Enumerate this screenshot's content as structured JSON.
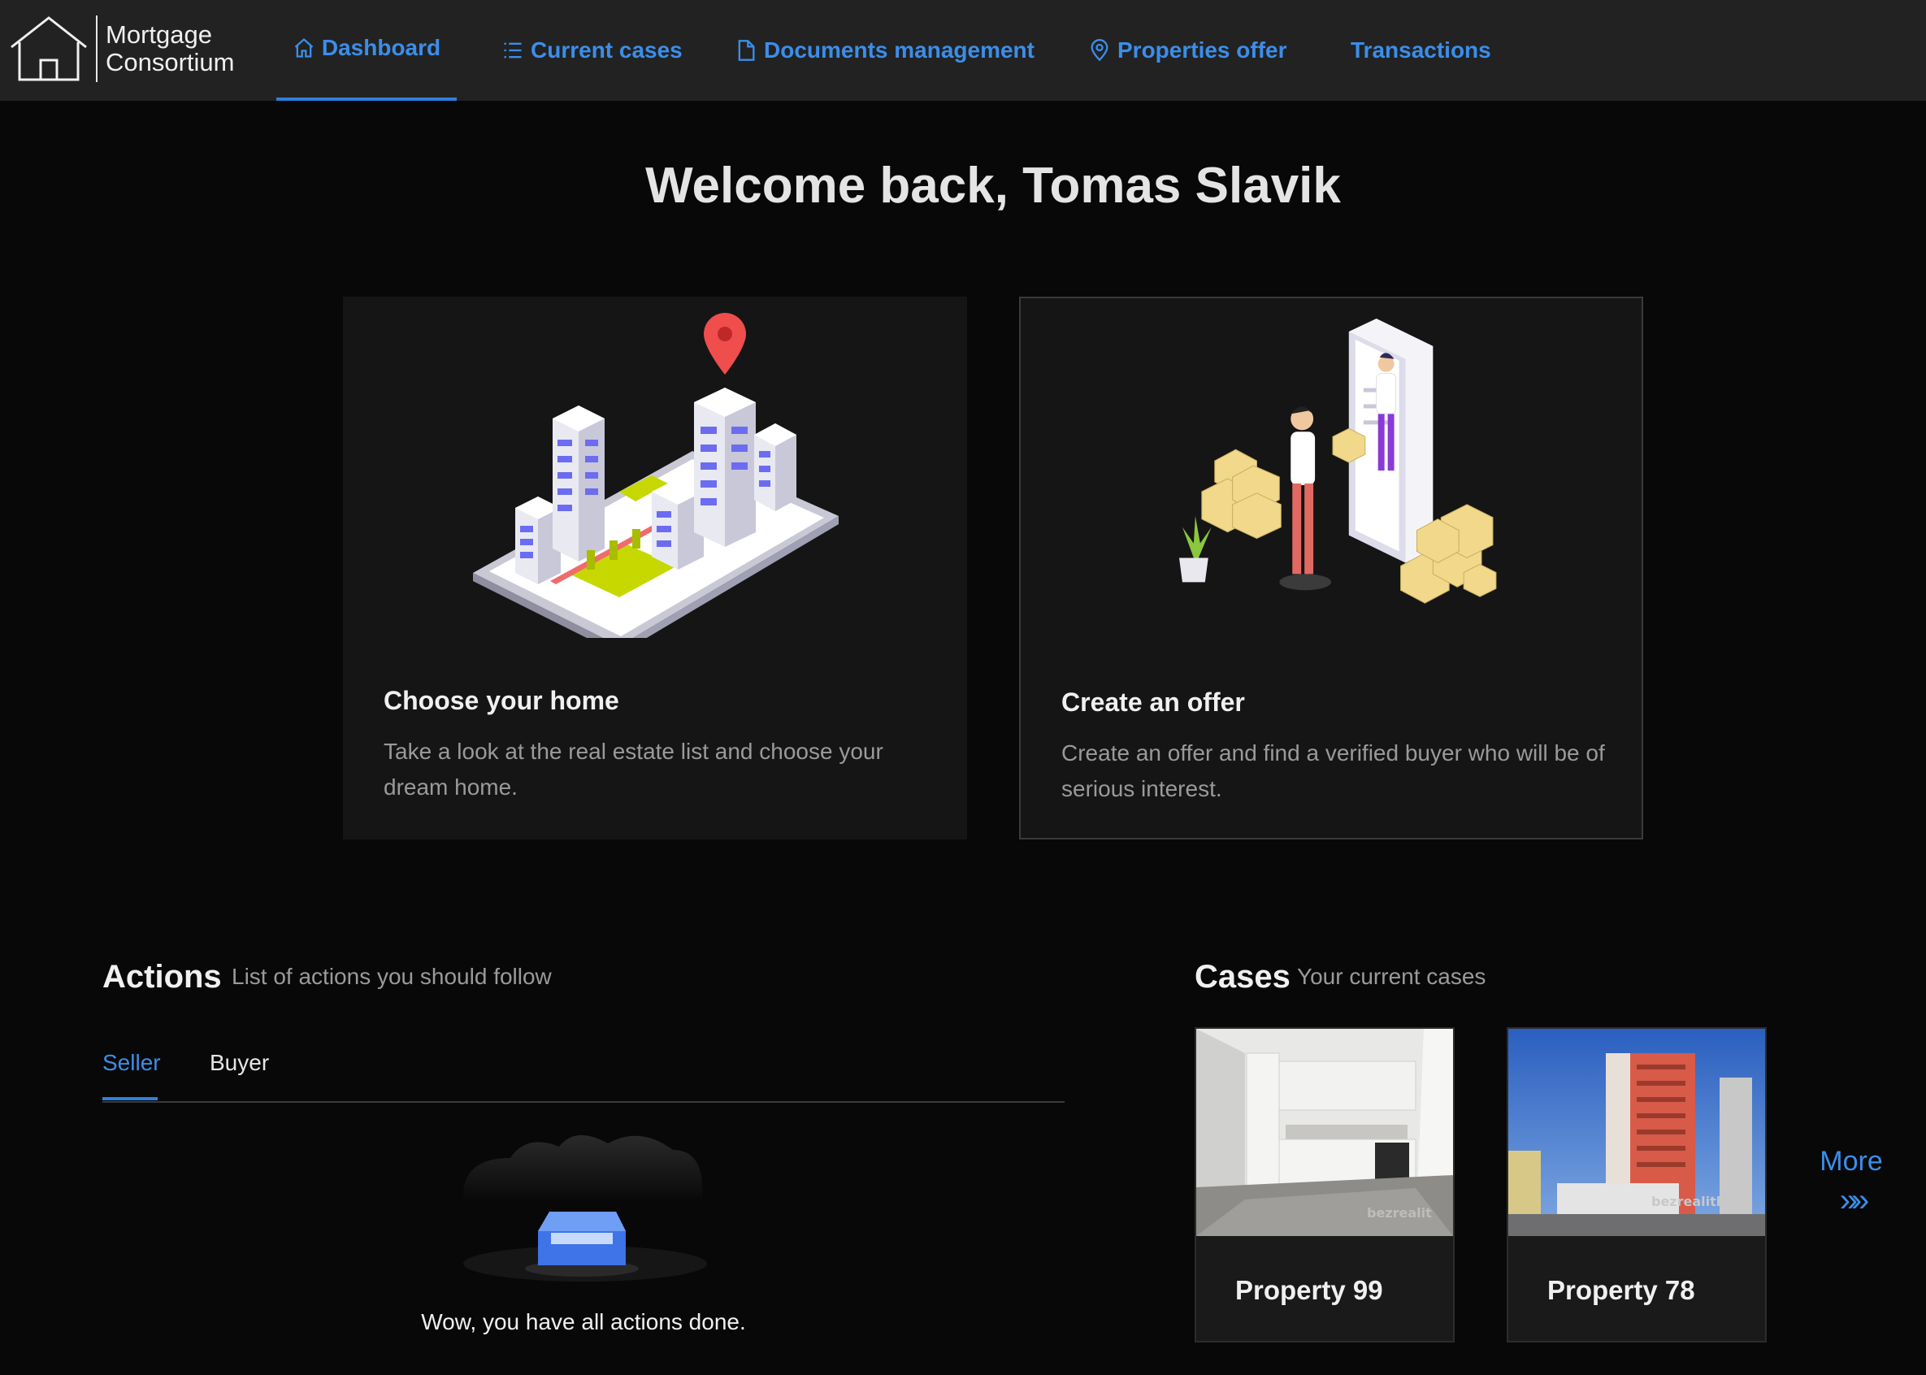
{
  "brand": {
    "line1": "Mortgage",
    "line2": "Consortium"
  },
  "nav": [
    {
      "label": "Dashboard",
      "icon": "home-icon",
      "active": true
    },
    {
      "label": "Current cases",
      "icon": "list-icon"
    },
    {
      "label": "Documents management",
      "icon": "document-icon"
    },
    {
      "label": "Properties offer",
      "icon": "location-pin-icon"
    },
    {
      "label": "Transactions",
      "icon": ""
    }
  ],
  "welcome": "Welcome back, Tomas Slavik",
  "cards": [
    {
      "title": "Choose your home",
      "description": "Take a look at the real estate list and choose your dream home."
    },
    {
      "title": "Create an offer",
      "description": "Create an offer and find a verified buyer who will be of serious interest."
    }
  ],
  "actions": {
    "title": "Actions",
    "subtitle": "List of actions you should follow",
    "tabs": [
      "Seller",
      "Buyer"
    ],
    "active_tab": "Seller",
    "empty_message": "Wow, you have all actions done."
  },
  "cases": {
    "title": "Cases",
    "subtitle": "Your current cases",
    "items": [
      {
        "label": "Property 99",
        "watermark": "bezrealit"
      },
      {
        "label": "Property 78",
        "watermark": "bezrealitky"
      }
    ],
    "more_label": "More",
    "more_icon": "double-chevron-right-icon"
  },
  "colors": {
    "accent": "#3b8eea",
    "background": "#080808",
    "nav": "#222222",
    "card": "#151515"
  }
}
